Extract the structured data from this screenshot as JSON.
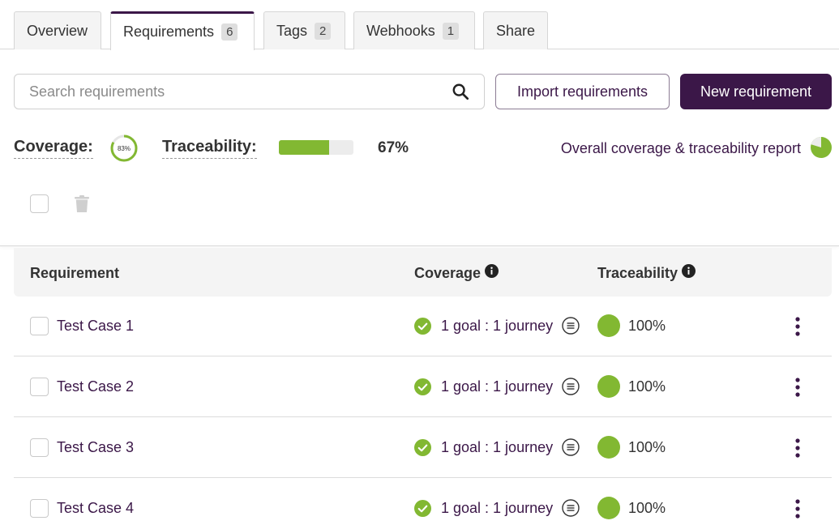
{
  "tabs": [
    {
      "label": "Overview",
      "count": null
    },
    {
      "label": "Requirements",
      "count": "6"
    },
    {
      "label": "Tags",
      "count": "2"
    },
    {
      "label": "Webhooks",
      "count": "1"
    },
    {
      "label": "Share",
      "count": null
    }
  ],
  "active_tab": "Requirements",
  "search": {
    "placeholder": "Search requirements",
    "value": ""
  },
  "actions": {
    "import_label": "Import requirements",
    "new_label": "New requirement"
  },
  "stats": {
    "coverage_label": "Coverage:",
    "coverage_value": "83%",
    "coverage_fraction": 0.83,
    "traceability_label": "Traceability:",
    "traceability_value": "67%",
    "traceability_fraction": 0.67
  },
  "report_link": "Overall coverage & traceability report",
  "table": {
    "headers": {
      "requirement": "Requirement",
      "coverage": "Coverage",
      "traceability": "Traceability"
    },
    "rows": [
      {
        "name": "Test Case 1",
        "coverage": "1 goal : 1 journey",
        "traceability": "100%"
      },
      {
        "name": "Test Case 2",
        "coverage": "1 goal : 1 journey",
        "traceability": "100%"
      },
      {
        "name": "Test Case 3",
        "coverage": "1 goal : 1 journey",
        "traceability": "100%"
      },
      {
        "name": "Test Case 4",
        "coverage": "1 goal : 1 journey",
        "traceability": "100%"
      }
    ]
  },
  "colors": {
    "brand": "#3b1748",
    "success": "#82b832",
    "track": "#ececec"
  },
  "icons": [
    "search-icon",
    "trash-icon",
    "info-icon",
    "check-circle-icon",
    "list-icon",
    "kebab-menu-icon",
    "pie-report-icon"
  ]
}
